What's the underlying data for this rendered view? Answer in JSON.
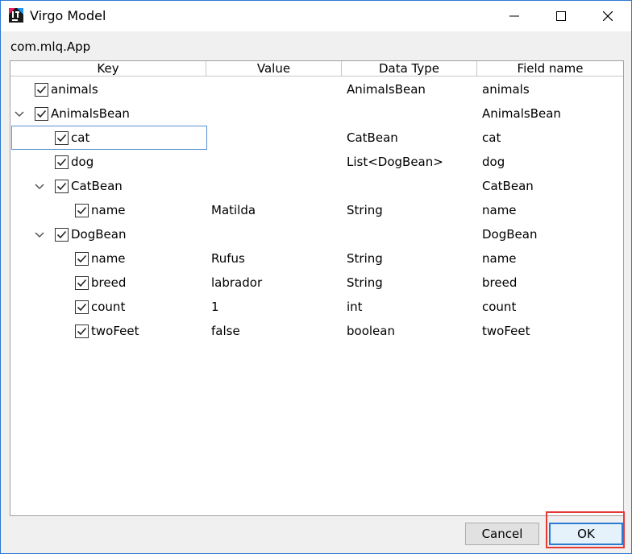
{
  "window": {
    "title": "Virgo Model",
    "minimize_label": "",
    "maximize_label": "",
    "close_label": ""
  },
  "package": "com.mlq.App",
  "table": {
    "columns": [
      "Key",
      "Value",
      "Data Type",
      "Field name"
    ],
    "rows": [
      {
        "key": "animals",
        "value": "",
        "type": "AnimalsBean",
        "field": "animals",
        "level": 0,
        "expandable": false
      },
      {
        "key": "AnimalsBean",
        "value": "",
        "type": "",
        "field": "AnimalsBean",
        "level": 0,
        "expandable": true
      },
      {
        "key": "cat",
        "value": "",
        "type": "CatBean",
        "field": "cat",
        "level": 1,
        "expandable": false
      },
      {
        "key": "dog",
        "value": "",
        "type": "List<DogBean>",
        "field": "dog",
        "level": 1,
        "expandable": false
      },
      {
        "key": "CatBean",
        "value": "",
        "type": "",
        "field": "CatBean",
        "level": 1,
        "expandable": true
      },
      {
        "key": "name",
        "value": "Matilda",
        "type": "String",
        "field": "name",
        "level": 2,
        "expandable": false
      },
      {
        "key": "DogBean",
        "value": "",
        "type": "",
        "field": "DogBean",
        "level": 1,
        "expandable": true
      },
      {
        "key": "name",
        "value": "Rufus",
        "type": "String",
        "field": "name",
        "level": 2,
        "expandable": false
      },
      {
        "key": "breed",
        "value": "labrador",
        "type": "String",
        "field": "breed",
        "level": 2,
        "expandable": false
      },
      {
        "key": "count",
        "value": "1",
        "type": "int",
        "field": "count",
        "level": 2,
        "expandable": false
      },
      {
        "key": "twoFeet",
        "value": "false",
        "type": "boolean",
        "field": "twoFeet",
        "level": 2,
        "expandable": false
      }
    ]
  },
  "buttons": {
    "cancel": "Cancel",
    "ok": "OK"
  },
  "icons": {
    "app": "intellij-icon",
    "checkbox": "checkmark-icon",
    "expand": "chevron-down-icon"
  },
  "colors": {
    "accent": "#2b79d0",
    "highlight": "#e53935"
  }
}
